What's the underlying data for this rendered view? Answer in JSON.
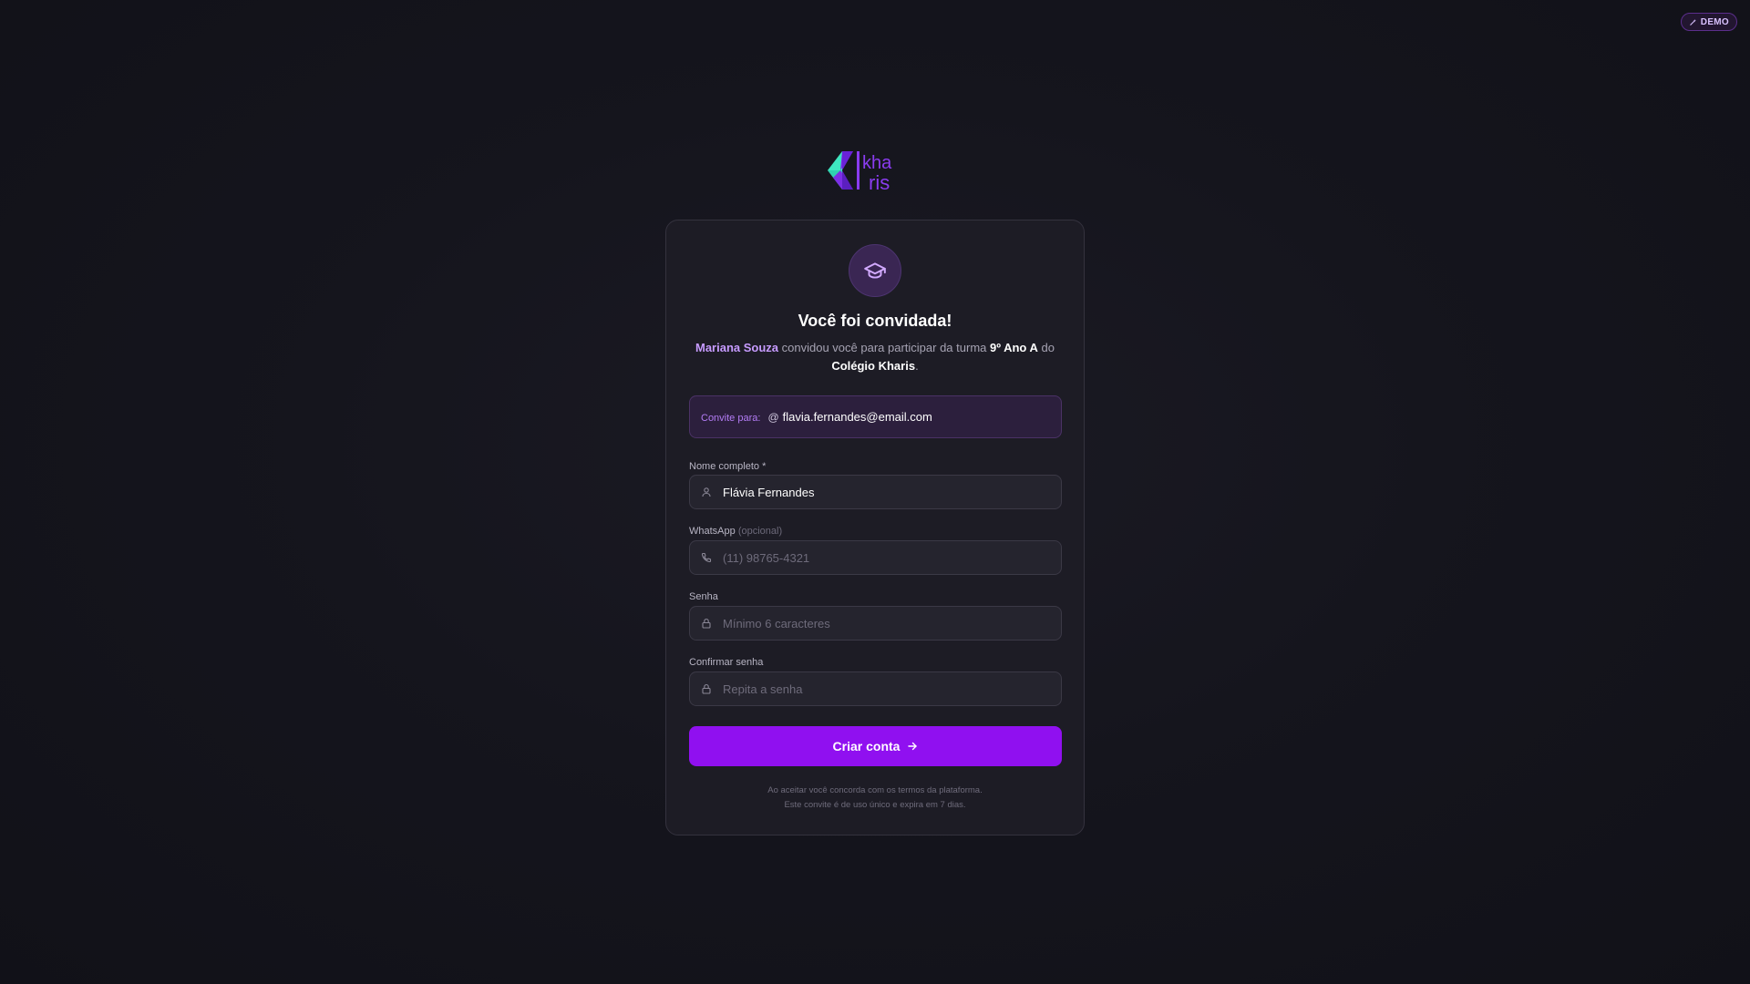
{
  "badge": {
    "label": "DEMO",
    "icon": "sparkle-icon"
  },
  "brand": {
    "name_top": "kha",
    "name_bottom": "ris",
    "accent": "#8a2be2",
    "accent_alt": "#3ee6c0"
  },
  "card": {
    "icon": "graduation-cap-icon",
    "title": "Você foi convidada!",
    "subtitle": {
      "inviter": "Mariana Souza",
      "text_1": " convidou você para participar da turma ",
      "class_name": "9º Ano A",
      "text_2": " do ",
      "school": "Colégio Kharis",
      "text_3": "."
    },
    "invite": {
      "label": "Convite para:",
      "at_symbol": "@",
      "email": "flavia.fernandes@email.com"
    },
    "fields": {
      "name": {
        "label": "Nome completo *",
        "value": "Flávia Fernandes",
        "placeholder": "",
        "icon": "user-icon"
      },
      "whatsapp": {
        "label": "WhatsApp",
        "optional": "(opcional)",
        "value": "",
        "placeholder": "(11) 98765-4321",
        "icon": "phone-icon"
      },
      "password": {
        "label": "Senha",
        "value": "",
        "placeholder": "Mínimo 6 caracteres",
        "icon": "lock-icon"
      },
      "confirm": {
        "label": "Confirmar senha",
        "value": "",
        "placeholder": "Repita a senha",
        "icon": "lock-icon"
      }
    },
    "submit_label": "Criar conta",
    "footer_line_1": "Ao aceitar você concorda com os termos da plataforma.",
    "footer_line_2": "Este convite é de uso único e expira em 7 dias."
  }
}
